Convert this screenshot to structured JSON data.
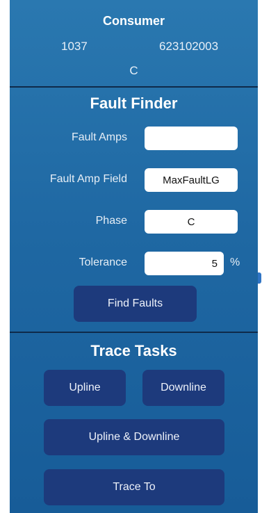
{
  "consumer": {
    "title": "Consumer",
    "id": "1037",
    "number": "623102003",
    "phase": "C"
  },
  "fault_finder": {
    "title": "Fault Finder",
    "fault_amps_label": "Fault Amps",
    "fault_amps_value": "",
    "fault_amp_field_label": "Fault Amp Field",
    "fault_amp_field_value": "MaxFaultLG",
    "phase_label": "Phase",
    "phase_value": "C",
    "tolerance_label": "Tolerance",
    "tolerance_value": "5",
    "tolerance_unit": "%",
    "find_button": "Find Faults"
  },
  "trace_tasks": {
    "title": "Trace Tasks",
    "upline_button": "Upline",
    "downline_button": "Downline",
    "upline_downline_button": "Upline & Downline",
    "trace_to_button": "Trace To"
  },
  "colors": {
    "panel_top": "#2a78b0",
    "panel_bottom": "#175c98",
    "button": "#1d3a7c",
    "divider": "#0f2a4a"
  }
}
